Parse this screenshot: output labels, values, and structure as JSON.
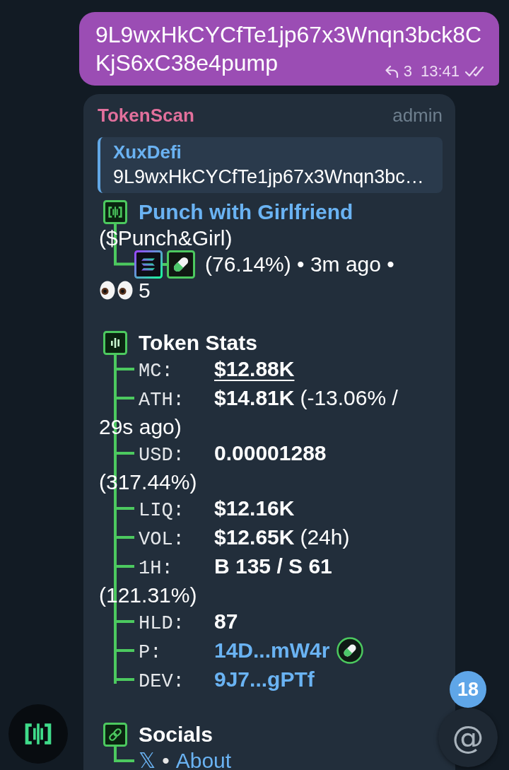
{
  "outgoing_message": {
    "lines": [
      "9L9wxHkCYCfTe1jp67x3Wnqn3bck8C",
      "KjS6xC38e4pump"
    ],
    "replies": "3",
    "time": "13:41",
    "read": true
  },
  "incoming_message": {
    "sender": "TokenScan",
    "role": "admin",
    "reply_quote": {
      "author": "XuxDefi",
      "text": "9L9wxHkCYCfTe1jp67x3Wnqn3bc…"
    },
    "token": {
      "name": "Punch with Girlfriend",
      "ticker": "($Punch&Girl)",
      "info": "(76.14%) • 3m ago •",
      "views": "5"
    },
    "stats": {
      "title": "Token Stats",
      "rows": [
        {
          "label": "MC:",
          "value": "$12.88K",
          "kind": "underlined",
          "badge": false
        },
        {
          "label": "ATH:",
          "value": "$14.81K",
          "extra": "(-13.06% /",
          "wrapped_line": "29s ago)",
          "kind": "plain",
          "badge": false
        },
        {
          "label": "USD:",
          "value": "0.00001288",
          "wrapped_line": "(317.44%)",
          "kind": "plain",
          "badge": false
        },
        {
          "label": "LIQ:",
          "value": "$12.16K",
          "kind": "plain",
          "badge": false
        },
        {
          "label": "VOL:",
          "value": "$12.65K",
          "extra": "(24h)",
          "kind": "plain",
          "badge": false
        },
        {
          "label": "1H:",
          "value": "B 135 / S 61",
          "wrapped_line": "(121.31%)",
          "kind": "plain",
          "badge": false
        },
        {
          "label": "HLD:",
          "value": "87",
          "kind": "plain",
          "badge": false
        },
        {
          "label": "P:",
          "value": "14D...mW4r",
          "kind": "link",
          "badge": true
        },
        {
          "label": "DEV:",
          "value": "9J7...gPTf",
          "kind": "link",
          "badge": false
        }
      ]
    },
    "socials": {
      "title": "Socials",
      "separator": "•",
      "links": [
        {
          "label": "𝕏"
        },
        {
          "label": "About"
        }
      ]
    }
  },
  "mention_button": {
    "icon": "@",
    "count": "18"
  }
}
